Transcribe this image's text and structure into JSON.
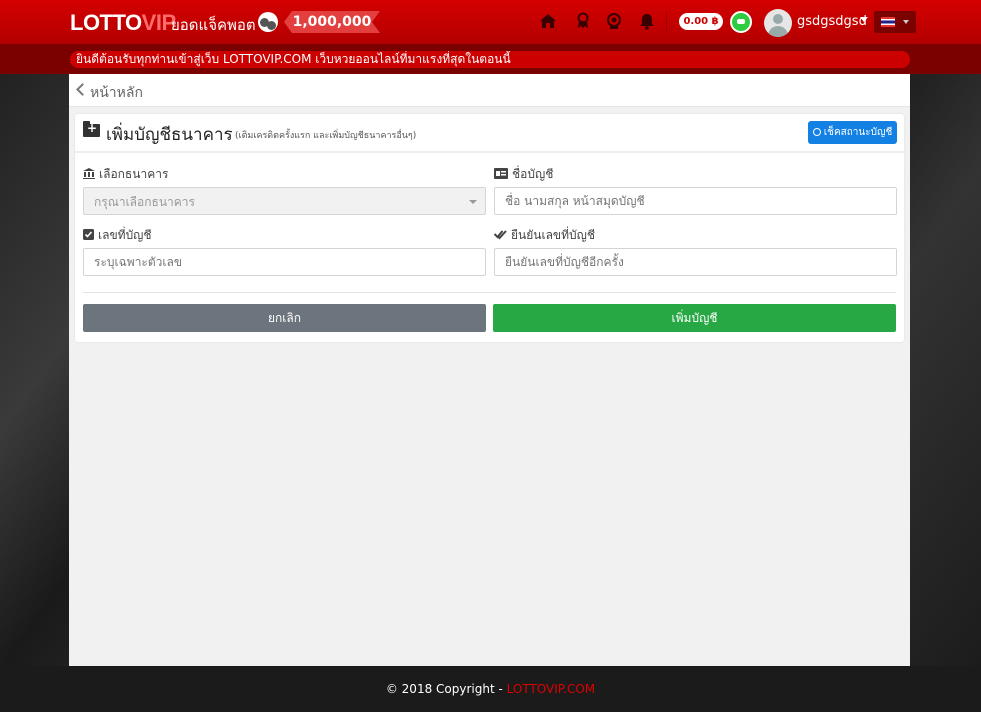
{
  "header": {
    "logo_part1": "LOTTO",
    "logo_part2": "VIP",
    "jackpot_label": "ยอดแจ็คพอต",
    "jackpot_value": "1,000,000",
    "balance": "0.00 ฿",
    "username": "gsdgsdgsd"
  },
  "marquee": {
    "text": "ยินดีต้อนรับทุกท่านเข้าสู่เว็บ LOTTOVIP.COM เว็บหวยออนไลน์ที่มาแรงที่สุดในตอนนี้"
  },
  "breadcrumb": {
    "label": "หน้าหลัก"
  },
  "form": {
    "title": "เพิ่มบัญชีธนาคาร",
    "subtitle": "(เติมเครดิตครั้งแรก และเพิ่มบัญชีธนาคารอื่นๆ)",
    "check_status_label": "เช็คสถานะบัญชี",
    "bank_label": "เลือกธนาคาร",
    "bank_placeholder": "กรุณาเลือกธนาคาร",
    "account_name_label": "ชื่อบัญชี",
    "account_name_placeholder": "ชื่อ นามสกุล หน้าสมุดบัญชี",
    "account_number_label": "เลขที่บัญชี",
    "account_number_placeholder": "ระบุเฉพาะตัวเลข",
    "confirm_number_label": "ยืนยันเลขที่บัญชี",
    "confirm_number_placeholder": "ยืนยันเลขที่บัญชีอีกครั้ง",
    "cancel_label": "ยกเลิก",
    "submit_label": "เพิ่มบัญชี"
  },
  "footer": {
    "copyright": "© 2018 Copyright - ",
    "brand": "LOTTOVIP.COM"
  },
  "colors": {
    "brand_red": "#cc0000",
    "primary_blue": "#1380e4",
    "success_green": "#28a745",
    "secondary_gray": "#6c757d"
  },
  "icons": [
    "home-icon",
    "award-icon",
    "trophy-icon",
    "bell-icon",
    "line-chat-icon",
    "bank-icon",
    "id-card-icon",
    "check-square-icon",
    "double-check-icon",
    "search-icon",
    "folder-plus-icon"
  ]
}
